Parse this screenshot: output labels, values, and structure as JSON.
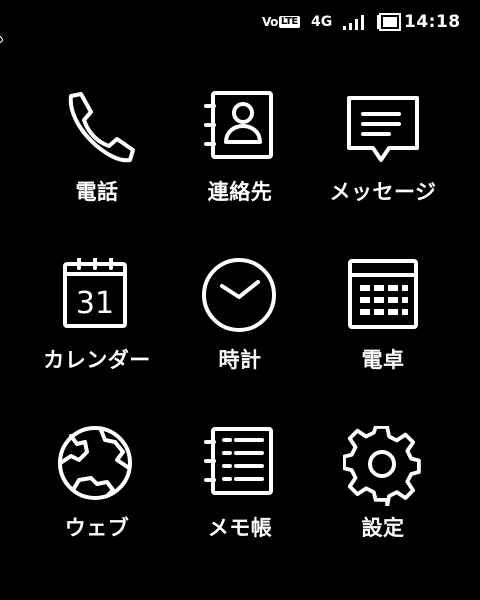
{
  "status_bar": {
    "volte_prefix": "Vo",
    "volte_box": "LTE",
    "network_type": "4G",
    "signal_icon": "signal-bars-icon",
    "battery_icon": "battery-icon",
    "time": "14:18"
  },
  "apps": [
    {
      "label": "電話",
      "icon": "phone-icon"
    },
    {
      "label": "連絡先",
      "icon": "contacts-icon"
    },
    {
      "label": "メッセージ",
      "icon": "message-icon"
    },
    {
      "label": "カレンダー",
      "icon": "calendar-icon",
      "calendar_day": "31"
    },
    {
      "label": "時計",
      "icon": "clock-icon"
    },
    {
      "label": "電卓",
      "icon": "calculator-icon"
    },
    {
      "label": "ウェブ",
      "icon": "globe-icon"
    },
    {
      "label": "メモ帳",
      "icon": "notepad-icon"
    },
    {
      "label": "設定",
      "icon": "gear-icon"
    }
  ],
  "colors": {
    "background": "#000000",
    "foreground": "#ffffff"
  }
}
